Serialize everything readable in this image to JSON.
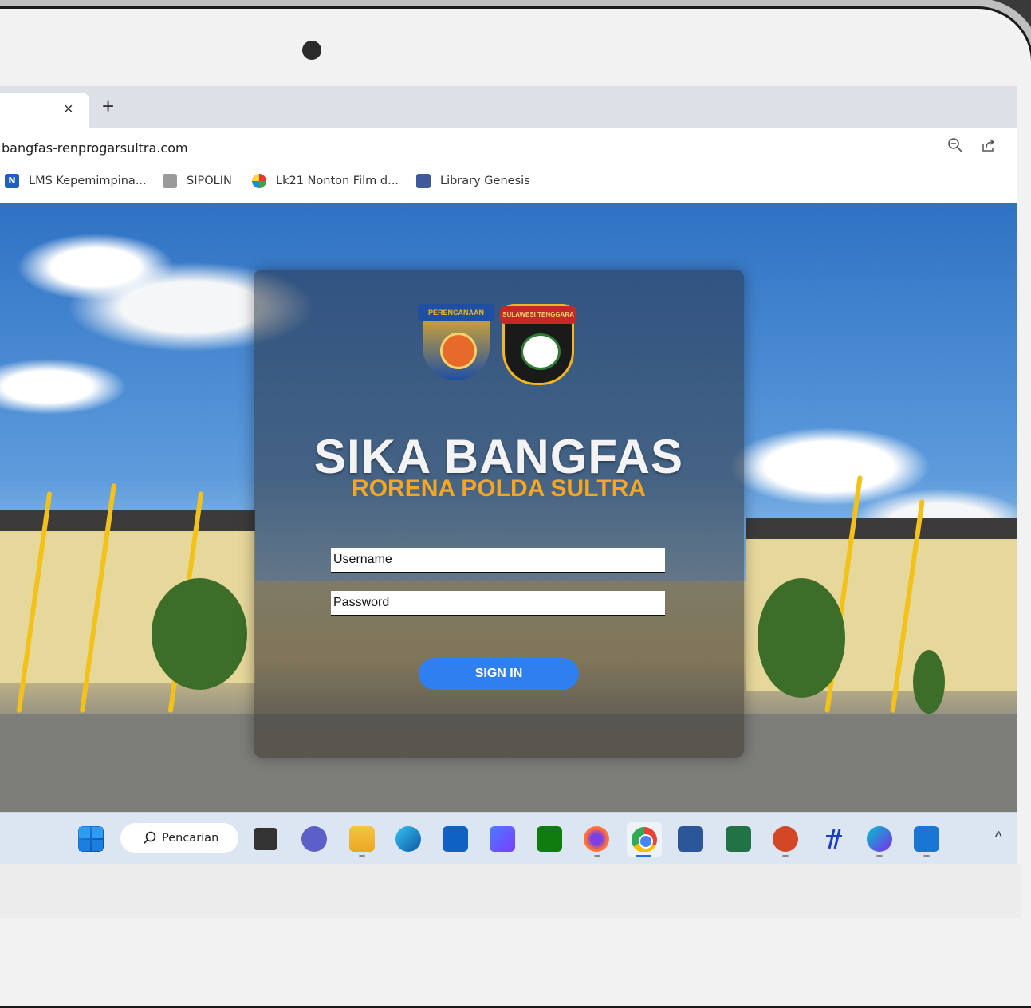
{
  "browser": {
    "tab_close": "×",
    "new_tab": "+",
    "url": "bangfas-renprogarsultra.com",
    "zoom_icon": "zoom-out-icon",
    "share_icon": "share-icon"
  },
  "bookmarks": [
    {
      "label": "LMS Kepemimpina...",
      "icon": "lms-icon"
    },
    {
      "label": "SIPOLIN",
      "icon": "sipolin-icon"
    },
    {
      "label": "Lk21 Nonton Film d...",
      "icon": "lk21-icon"
    },
    {
      "label": "Library Genesis",
      "icon": "libgen-icon"
    }
  ],
  "login": {
    "logo_left_text": "PERENCANAAN",
    "logo_right_text": "SULAWESI TENGGARA",
    "title": "SIKA BANGFAS",
    "subtitle": "RORENA POLDA SULTRA",
    "username_placeholder": "Username",
    "password_placeholder": "Password",
    "signin_label": "SIGN IN"
  },
  "taskbar": {
    "search_label": "Pencarian",
    "chevron": "^"
  },
  "colors": {
    "accent": "#2f7ff0",
    "subtitle": "#f5a623",
    "taskbar": "#dbe6f2"
  }
}
